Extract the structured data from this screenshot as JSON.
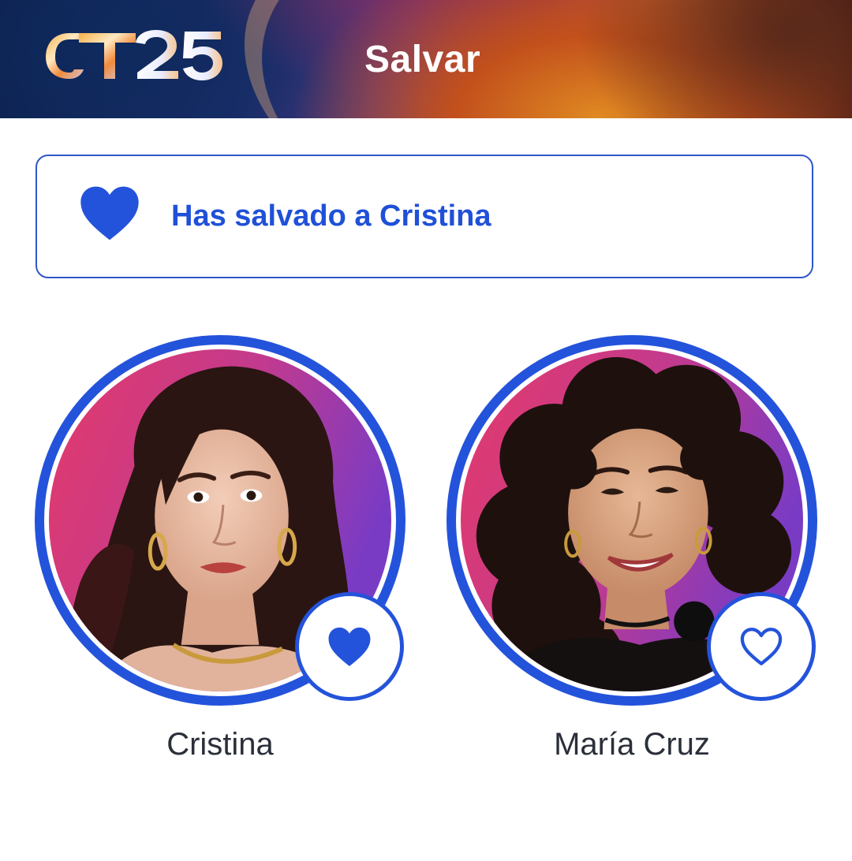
{
  "header": {
    "logo_text": "OT25",
    "title": "Salvar"
  },
  "banner": {
    "icon": "heart-filled-icon",
    "message": "Has salvado a Cristina"
  },
  "contestants": [
    {
      "name": "Cristina",
      "saved": true,
      "save_icon": "heart-filled-icon"
    },
    {
      "name": "María Cruz",
      "saved": false,
      "save_icon": "heart-outline-icon"
    }
  ],
  "colors": {
    "accent": "#2453db",
    "banner_text": "#2050d8",
    "name_text": "#2a2f3a",
    "header_title": "#ffffff"
  }
}
